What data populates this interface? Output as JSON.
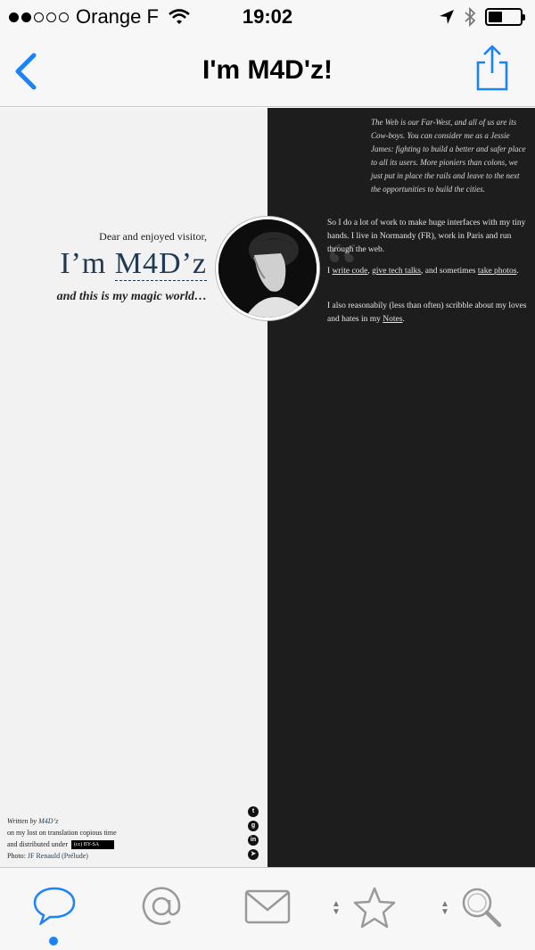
{
  "status_bar": {
    "carrier": "Orange F",
    "time": "19:02",
    "signal_bars_filled": 2,
    "signal_bars_total": 5,
    "battery_level": 0.45
  },
  "nav": {
    "title": "I'm M4D'z!",
    "back_icon": "chevron-left-icon",
    "share_icon": "share-icon",
    "accent": "#1a82fb"
  },
  "page": {
    "greeting": "Dear and enjoyed visitor,",
    "name_prefix": "I’m ",
    "name_handle": "M4D’z",
    "tagline": "and this is my magic world…",
    "quote": "The Web is our Far-West, and all of us are its Cow-boys. You can consider me as a Jessie James: fighting to build a better and safer place to all its users. More pioniers than colons, we just put in place the rails and leave to the next the opportunities to build the cities.",
    "bio_p1": "So I do a lot of work to make huge interfaces with my tiny hands. I live in Normandy (FR), work in Paris and run through the web.",
    "bio_p2_start": "I ",
    "bio_link_code": "write code",
    "bio_sep1": ", ",
    "bio_link_talks": "give tech talks",
    "bio_sep2": ", and sometimes ",
    "bio_link_photos": "take photos",
    "bio_p2_end": ".",
    "bio_p3_start": "I also reasonabily (less than often) scribble about my loves and hates in my ",
    "bio_link_notes": "Notes",
    "bio_p3_end": ".",
    "footer_written": "Written by ",
    "footer_author": "M4D’z",
    "footer_line2": "on my lost on translation copious time",
    "footer_line3": "and distributed under",
    "footer_license": "(cc) BY-SA",
    "footer_photo_label": "Photo: ",
    "footer_photo_author": "JF Renauld",
    "footer_photo_work": "(Prélude)",
    "social_icons": [
      "twitter-icon",
      "github-icon",
      "linkedin-icon",
      "telegram-icon"
    ]
  },
  "tabbar": {
    "tabs": [
      {
        "icon": "speech-bubble-icon",
        "active": true
      },
      {
        "icon": "at-sign-icon",
        "active": false
      },
      {
        "icon": "mail-icon",
        "active": false
      },
      {
        "icon": "star-icon",
        "active": false
      },
      {
        "icon": "search-icon",
        "active": false
      }
    ]
  }
}
